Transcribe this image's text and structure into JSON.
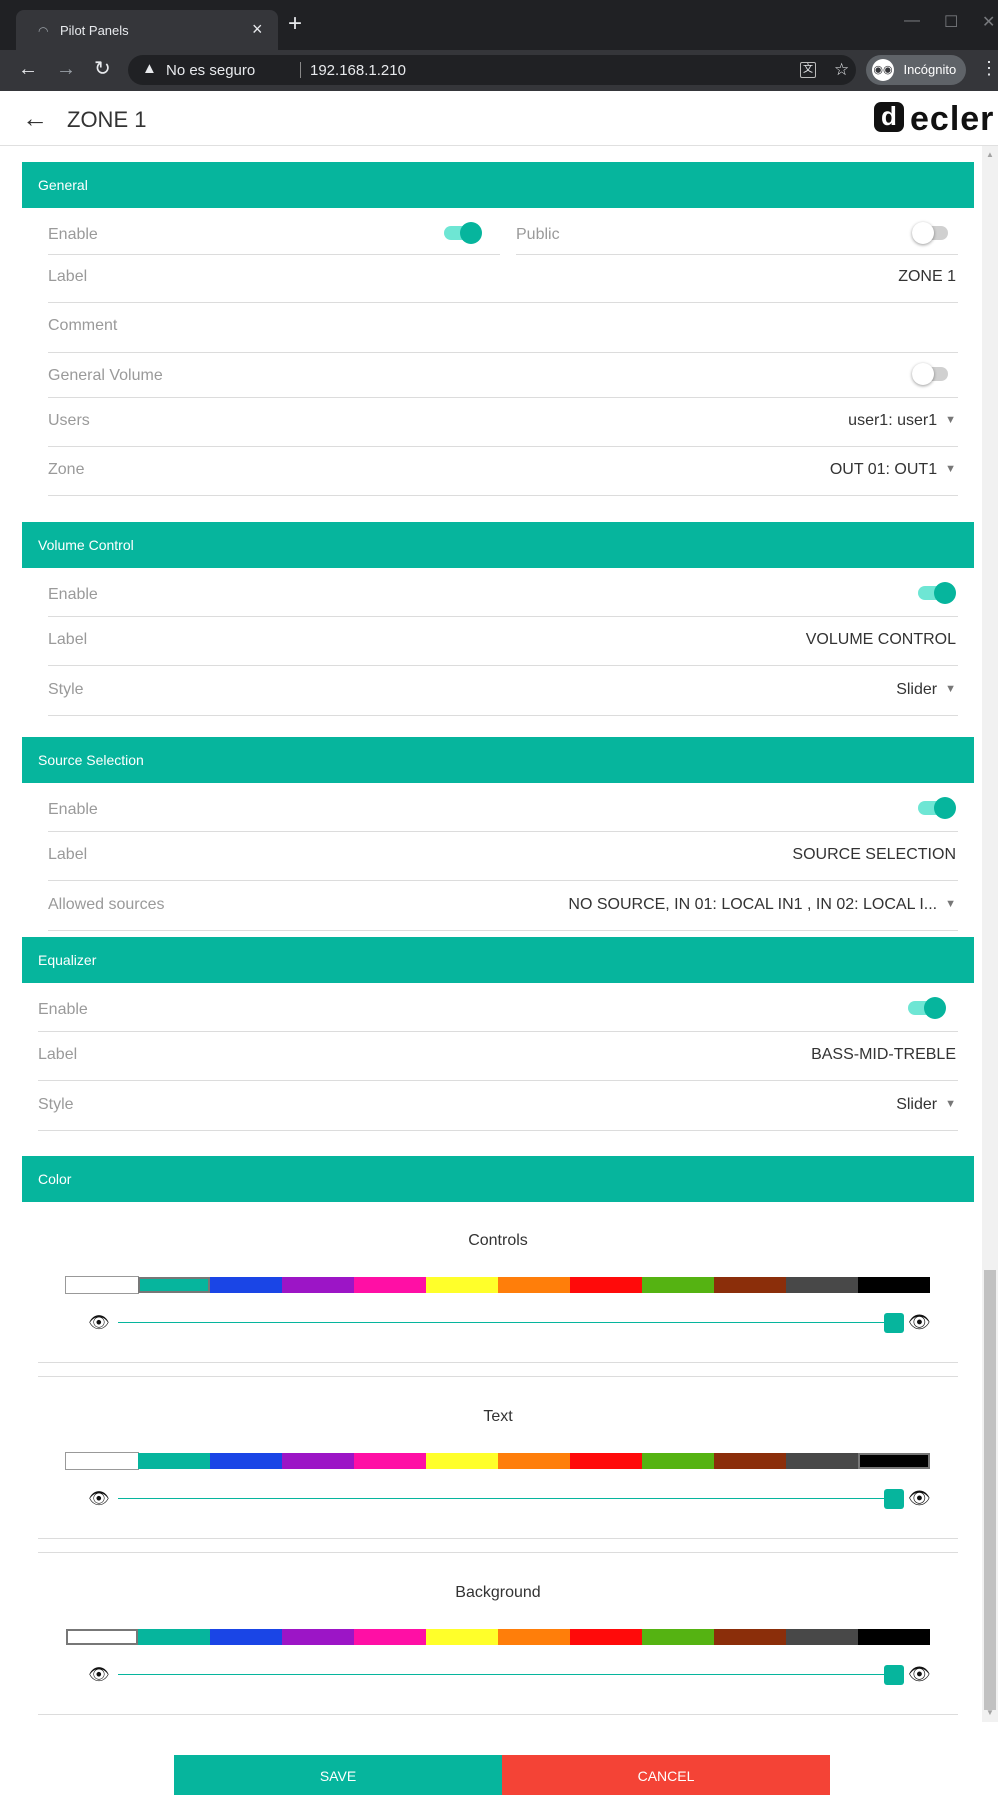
{
  "browser": {
    "tab_title": "Pilot Panels",
    "security_text": "No es seguro",
    "url": "192.168.1.210",
    "incognito_label": "Incógnito"
  },
  "header": {
    "title": "ZONE 1",
    "logo_text": "ecler"
  },
  "general": {
    "title": "General",
    "enable_label": "Enable",
    "public_label": "Public",
    "label_label": "Label",
    "label_value": "ZONE 1",
    "comment_label": "Comment",
    "general_volume_label": "General Volume",
    "users_label": "Users",
    "users_value": "user1: user1",
    "zone_label": "Zone",
    "zone_value": "OUT 01: OUT1",
    "enable_on": true,
    "public_on": false,
    "general_volume_on": false
  },
  "volume_control": {
    "title": "Volume Control",
    "enable_label": "Enable",
    "label_label": "Label",
    "label_value": "VOLUME CONTROL",
    "style_label": "Style",
    "style_value": "Slider",
    "enable_on": true
  },
  "source_selection": {
    "title": "Source Selection",
    "enable_label": "Enable",
    "label_label": "Label",
    "label_value": "SOURCE SELECTION",
    "allowed_label": "Allowed sources",
    "allowed_value": "NO SOURCE, IN 01: LOCAL IN1 , IN 02: LOCAL I...",
    "enable_on": true
  },
  "equalizer": {
    "title": "Equalizer",
    "enable_label": "Enable",
    "label_label": "Label",
    "label_value": "BASS-MID-TREBLE",
    "style_label": "Style",
    "style_value": "Slider",
    "enable_on": true
  },
  "color": {
    "title": "Color",
    "palette": [
      "#ffffff",
      "#06b59d",
      "#1a45e6",
      "#9c15c6",
      "#ff0fa5",
      "#ffff2a",
      "#ff7e0a",
      "#ff0a0a",
      "#55b312",
      "#8b2e0a",
      "#484848",
      "#000000"
    ],
    "controls": {
      "title": "Controls",
      "selected_index": 1,
      "opacity_fraction": 1.0
    },
    "text": {
      "title": "Text",
      "selected_index": 11,
      "opacity_fraction": 1.0
    },
    "background": {
      "title": "Background",
      "selected_index": 0,
      "opacity_fraction": 1.0
    }
  },
  "footer": {
    "save_label": "SAVE",
    "cancel_label": "CANCEL"
  }
}
